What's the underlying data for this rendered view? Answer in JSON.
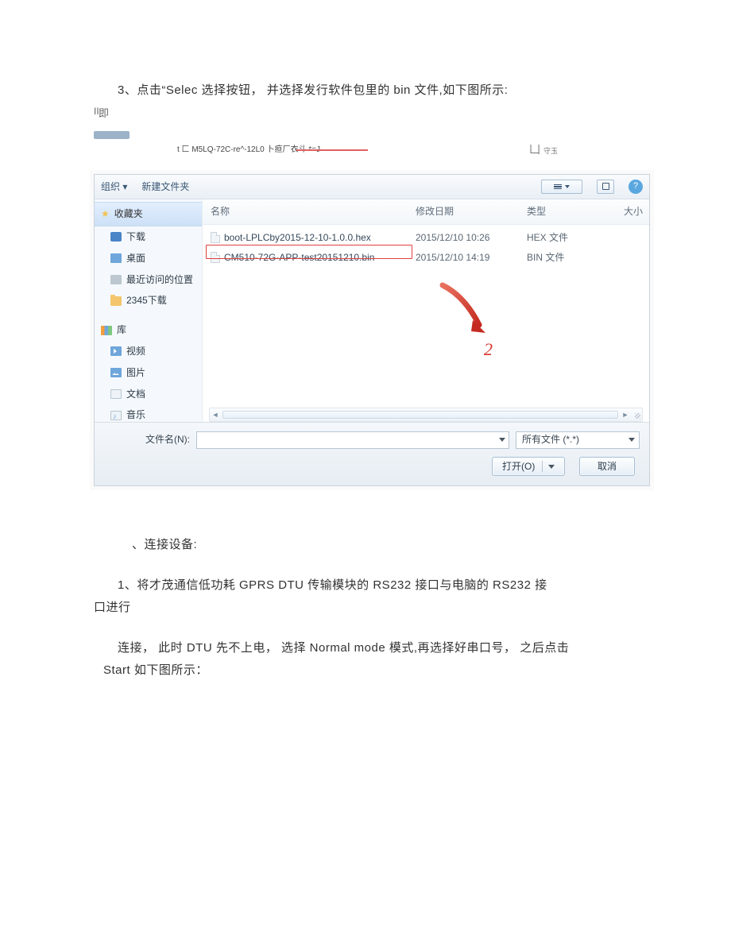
{
  "text": {
    "line1": "3、点击“Selec 选择按钮， 并选择发行软件包里的 bin 文件,如下图所示:",
    "frag_mark": "II",
    "frag_ji": "即",
    "path_text": "t 匚 M5LQ-72C-re^-12L0 卜疸厂衣斗 *=J",
    "path_right_box": "凵",
    "path_right_small": "守玉",
    "section2_title": "、连接设备:",
    "para2_a": "1、将才茂通信低功耗  GPRS DTU 传输模块的 RS232 接口与电脑的 RS232 接",
    "para2_b": "口进行",
    "para3_a": "连接， 此时 DTU 先不上电， 选择 Normal mode 模式,再选择好串口号， 之后点击",
    "para3_b": "Start 如下图所示：",
    "anno_number": "2"
  },
  "dialog": {
    "toolbar": {
      "organize": "组织 ▾",
      "newfolder": "新建文件夹"
    },
    "columns": {
      "name": "名称",
      "date": "修改日期",
      "type": "类型",
      "size": "大小"
    },
    "sidebar": {
      "favorites": "收藏夹",
      "downloads": "下载",
      "desktop": "桌面",
      "recent": "最近访问的位置",
      "dl2345": "2345下载",
      "libs": "库",
      "video": "视频",
      "pictures": "图片",
      "docs": "文档",
      "music": "音乐"
    },
    "files": [
      {
        "name": "boot-LPLCby2015-12-10-1.0.0.hex",
        "date": "2015/12/10 10:26",
        "type": "HEX 文件"
      },
      {
        "name": "CM510-72G-APP-test20151210.bin",
        "date": "2015/12/10 14:19",
        "type": "BIN 文件"
      }
    ],
    "footer": {
      "filename_label": "文件名(N):",
      "filter": "所有文件 (*.*)",
      "open": "打开(O)",
      "cancel": "取消"
    }
  }
}
